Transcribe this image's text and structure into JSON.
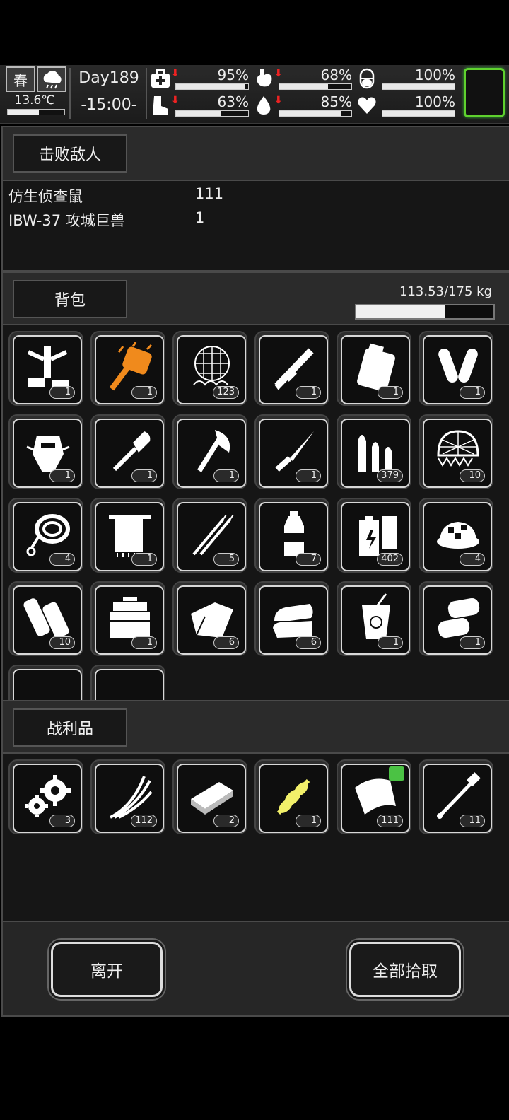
{
  "status": {
    "season": "春",
    "temperature": "13.6℃",
    "temperature_level": 0.55,
    "day": "Day189",
    "time": "-15:00-",
    "stats": [
      {
        "icon": "medkit-icon",
        "value": "95%",
        "level": 0.95,
        "down": true
      },
      {
        "icon": "stomach-icon",
        "value": "68%",
        "level": 0.68,
        "down": true
      },
      {
        "icon": "pill-icon",
        "value": "100%",
        "level": 1.0,
        "down": false
      },
      {
        "icon": "boot-icon",
        "value": "63%",
        "level": 0.63,
        "down": true
      },
      {
        "icon": "water-drop-icon",
        "value": "85%",
        "level": 0.85,
        "down": true
      },
      {
        "icon": "heart-icon",
        "value": "100%",
        "level": 1.0,
        "down": false
      }
    ]
  },
  "defeated": {
    "title": "击败敌人",
    "enemies": [
      {
        "name": "仿生侦查鼠",
        "count": "111"
      },
      {
        "name": "IBW-37 攻城巨兽",
        "count": "1"
      }
    ]
  },
  "backpack": {
    "title": "背包",
    "weight": "113.53/175 kg",
    "weight_level": 0.6487,
    "items": [
      {
        "icon": "power-armor-frame-icon",
        "count": "1"
      },
      {
        "icon": "flame-gauntlet-icon",
        "count": "1",
        "color": "#f08a1c"
      },
      {
        "icon": "net-icon",
        "count": "123"
      },
      {
        "icon": "minigun-icon",
        "count": "1"
      },
      {
        "icon": "backpack-case-icon",
        "count": "1"
      },
      {
        "icon": "leg-guards-icon",
        "count": "1"
      },
      {
        "icon": "robot-head-icon",
        "count": "1"
      },
      {
        "icon": "shovel-icon",
        "count": "1"
      },
      {
        "icon": "axe-icon",
        "count": "1"
      },
      {
        "icon": "knife-icon",
        "count": "1"
      },
      {
        "icon": "bullets-icon",
        "count": "379"
      },
      {
        "icon": "helmet-net-icon",
        "count": "10"
      },
      {
        "icon": "rope-icon",
        "count": "4"
      },
      {
        "icon": "towel-icon",
        "count": "1"
      },
      {
        "icon": "tweezers-icon",
        "count": "5"
      },
      {
        "icon": "water-bottle-icon",
        "count": "7"
      },
      {
        "icon": "battery-icon",
        "count": "402"
      },
      {
        "icon": "food-bowl-icon",
        "count": "4"
      },
      {
        "icon": "bandage-roll-icon",
        "count": "10"
      },
      {
        "icon": "toolbox-icon",
        "count": "1"
      },
      {
        "icon": "cloth-icon",
        "count": "6"
      },
      {
        "icon": "folded-clothes-icon",
        "count": "6"
      },
      {
        "icon": "juice-icon",
        "count": "1"
      },
      {
        "icon": "tofu-icon",
        "count": "1"
      },
      {
        "icon": "pills-icon",
        "count": ""
      },
      {
        "icon": "beaker-icon",
        "count": ""
      }
    ]
  },
  "loot": {
    "title": "战利品",
    "items": [
      {
        "icon": "gears-icon",
        "count": "3"
      },
      {
        "icon": "wires-icon",
        "count": "112"
      },
      {
        "icon": "metal-plate-icon",
        "count": "2"
      },
      {
        "icon": "spring-icon",
        "count": "1",
        "color": "#f2f06a"
      },
      {
        "icon": "fabric-scrap-icon",
        "count": "111",
        "badge": true
      },
      {
        "icon": "pipe-icon",
        "count": "11"
      }
    ]
  },
  "actions": {
    "leave": "离开",
    "take_all": "全部拾取"
  }
}
